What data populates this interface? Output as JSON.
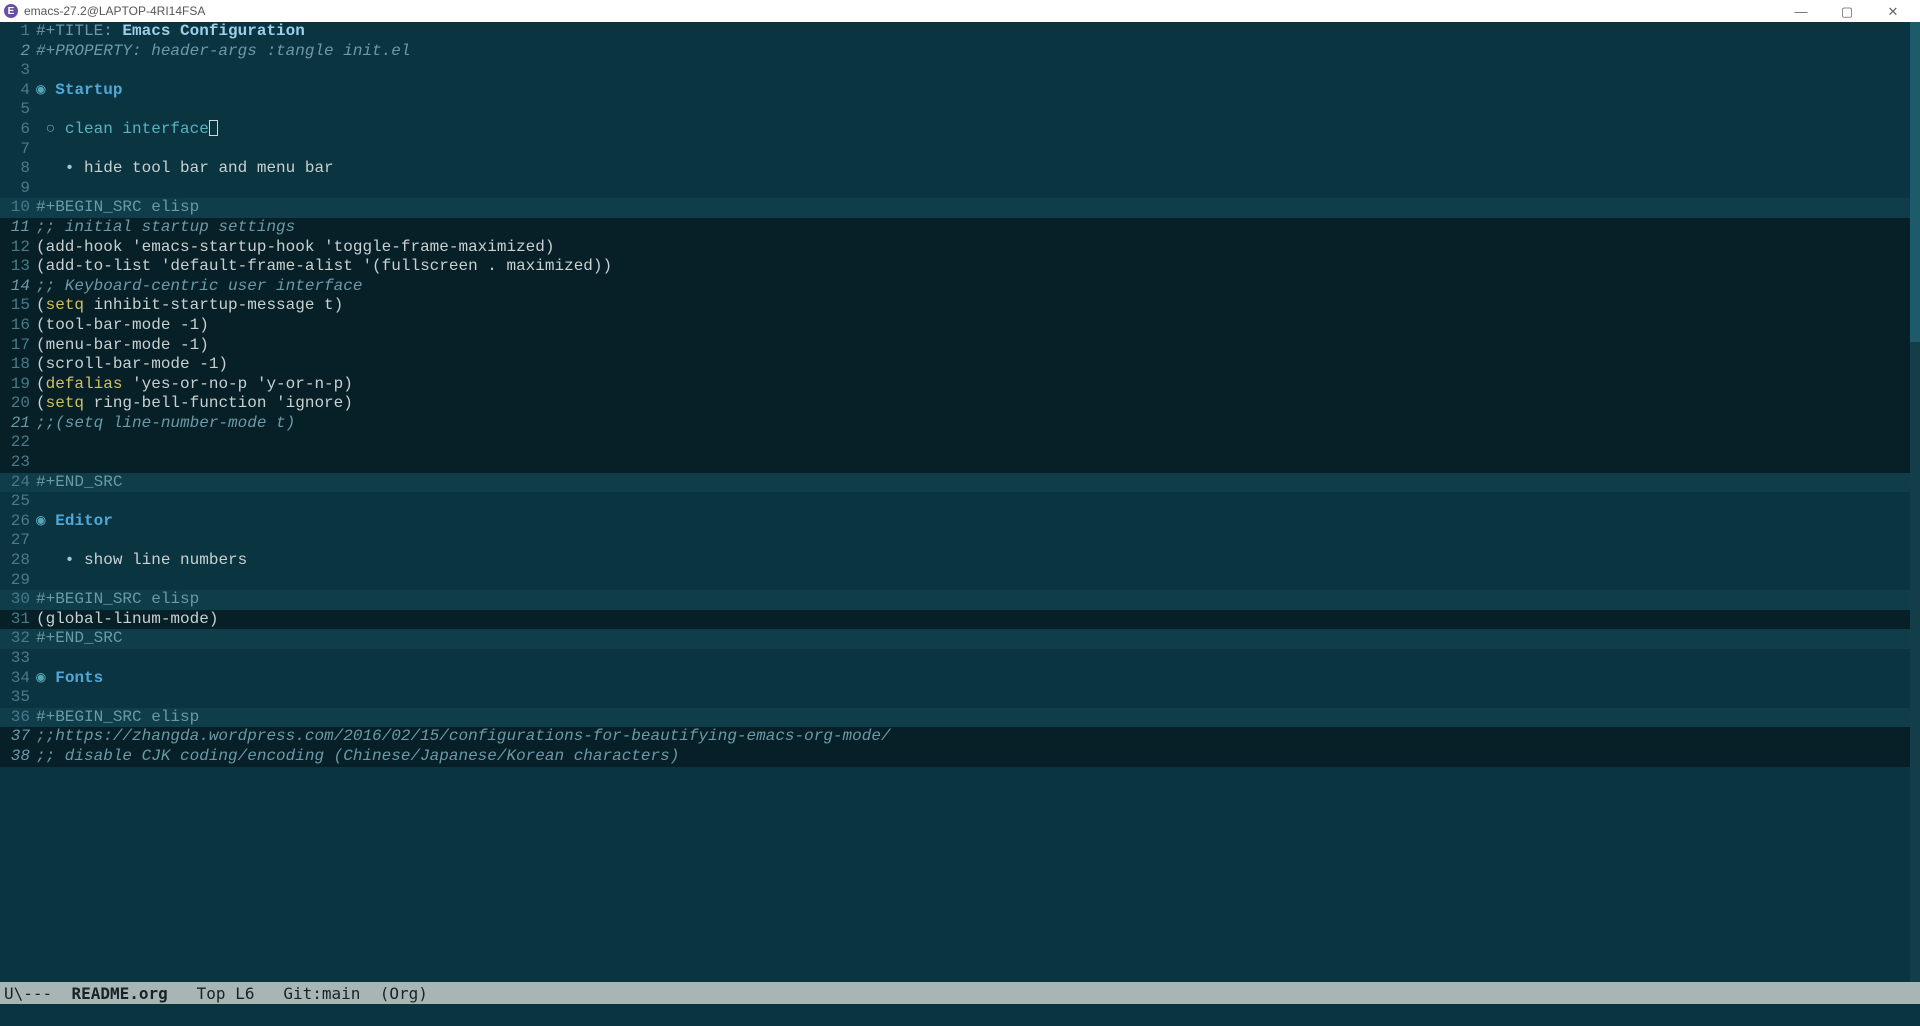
{
  "window": {
    "title": "emacs-27.2@LAPTOP-4RI14FSA",
    "icon_letter": "E"
  },
  "modeline": {
    "left": "U\\---  ",
    "buffer": "README.org",
    "pos": "   Top L6",
    "vc": "   Git:main",
    "mode": "  (Org)"
  },
  "lines": [
    {
      "n": "1",
      "italic": false,
      "bg": "normal",
      "spans": [
        {
          "cls": "c-meta",
          "t": "#+TITLE: "
        },
        {
          "cls": "c-title",
          "t": "Emacs Configuration"
        }
      ]
    },
    {
      "n": "2",
      "italic": true,
      "bg": "normal",
      "spans": [
        {
          "cls": "c-comment",
          "t": "#+PROPERTY: header-args :tangle init.el"
        }
      ]
    },
    {
      "n": "3",
      "italic": false,
      "bg": "normal",
      "spans": [
        {
          "cls": "c-text",
          "t": ""
        }
      ]
    },
    {
      "n": "4",
      "italic": false,
      "bg": "normal",
      "spans": [
        {
          "cls": "c-marker",
          "t": "◉ "
        },
        {
          "cls": "c-heading1",
          "t": "Startup"
        }
      ]
    },
    {
      "n": "5",
      "italic": false,
      "bg": "normal",
      "spans": [
        {
          "cls": "c-text",
          "t": ""
        }
      ]
    },
    {
      "n": "6",
      "italic": false,
      "bg": "normal",
      "cursor": true,
      "spans": [
        {
          "cls": "c-marker",
          "t": " ○ "
        },
        {
          "cls": "c-heading2",
          "t": "clean interface"
        }
      ]
    },
    {
      "n": "7",
      "italic": false,
      "bg": "normal",
      "spans": [
        {
          "cls": "c-text",
          "t": ""
        }
      ]
    },
    {
      "n": "8",
      "italic": false,
      "bg": "normal",
      "spans": [
        {
          "cls": "c-bullet",
          "t": "   • "
        },
        {
          "cls": "c-text",
          "t": "hide tool bar and menu bar"
        }
      ]
    },
    {
      "n": "9",
      "italic": false,
      "bg": "normal",
      "spans": [
        {
          "cls": "c-text",
          "t": ""
        }
      ]
    },
    {
      "n": "10",
      "italic": false,
      "bg": "begin",
      "spans": [
        {
          "cls": "c-meta",
          "t": "#+BEGIN_SRC elisp"
        }
      ]
    },
    {
      "n": "11",
      "italic": true,
      "bg": "src",
      "spans": [
        {
          "cls": "c-comment",
          "t": ";; initial startup settings"
        }
      ]
    },
    {
      "n": "12",
      "italic": false,
      "bg": "src",
      "spans": [
        {
          "cls": "c-text",
          "t": "(add-hook 'emacs-startup-hook 'toggle-frame-maximized)"
        }
      ]
    },
    {
      "n": "13",
      "italic": false,
      "bg": "src",
      "spans": [
        {
          "cls": "c-text",
          "t": "(add-to-list 'default-frame-alist '(fullscreen . maximized))"
        }
      ]
    },
    {
      "n": "14",
      "italic": true,
      "bg": "src",
      "spans": [
        {
          "cls": "c-comment",
          "t": ";; Keyboard-centric user interface"
        }
      ]
    },
    {
      "n": "15",
      "italic": false,
      "bg": "src",
      "spans": [
        {
          "cls": "c-text",
          "t": "("
        },
        {
          "cls": "c-keyword",
          "t": "setq"
        },
        {
          "cls": "c-text",
          "t": " inhibit-startup-message t)"
        }
      ]
    },
    {
      "n": "16",
      "italic": false,
      "bg": "src",
      "spans": [
        {
          "cls": "c-text",
          "t": "(tool-bar-mode -1)"
        }
      ]
    },
    {
      "n": "17",
      "italic": false,
      "bg": "src",
      "spans": [
        {
          "cls": "c-text",
          "t": "(menu-bar-mode -1)"
        }
      ]
    },
    {
      "n": "18",
      "italic": false,
      "bg": "src",
      "spans": [
        {
          "cls": "c-text",
          "t": "(scroll-bar-mode -1)"
        }
      ]
    },
    {
      "n": "19",
      "italic": false,
      "bg": "src",
      "spans": [
        {
          "cls": "c-text",
          "t": "("
        },
        {
          "cls": "c-keyword",
          "t": "defalias"
        },
        {
          "cls": "c-text",
          "t": " 'yes-or-no-p 'y-or-n-p)"
        }
      ]
    },
    {
      "n": "20",
      "italic": false,
      "bg": "src",
      "spans": [
        {
          "cls": "c-text",
          "t": "("
        },
        {
          "cls": "c-keyword",
          "t": "setq"
        },
        {
          "cls": "c-text",
          "t": " ring-bell-function 'ignore)"
        }
      ]
    },
    {
      "n": "21",
      "italic": true,
      "bg": "src",
      "spans": [
        {
          "cls": "c-comment",
          "t": ";;(setq line-number-mode t)"
        }
      ]
    },
    {
      "n": "22",
      "italic": false,
      "bg": "src",
      "spans": [
        {
          "cls": "c-text",
          "t": ""
        }
      ]
    },
    {
      "n": "23",
      "italic": false,
      "bg": "src",
      "spans": [
        {
          "cls": "c-text",
          "t": ""
        }
      ]
    },
    {
      "n": "24",
      "italic": false,
      "bg": "begin",
      "spans": [
        {
          "cls": "c-meta",
          "t": "#+END_SRC"
        }
      ]
    },
    {
      "n": "25",
      "italic": false,
      "bg": "normal",
      "spans": [
        {
          "cls": "c-text",
          "t": ""
        }
      ]
    },
    {
      "n": "26",
      "italic": false,
      "bg": "normal",
      "spans": [
        {
          "cls": "c-marker",
          "t": "◉ "
        },
        {
          "cls": "c-heading1",
          "t": "Editor"
        }
      ]
    },
    {
      "n": "27",
      "italic": false,
      "bg": "normal",
      "spans": [
        {
          "cls": "c-text",
          "t": ""
        }
      ]
    },
    {
      "n": "28",
      "italic": false,
      "bg": "normal",
      "spans": [
        {
          "cls": "c-bullet",
          "t": "   • "
        },
        {
          "cls": "c-text",
          "t": "show line numbers"
        }
      ]
    },
    {
      "n": "29",
      "italic": false,
      "bg": "normal",
      "spans": [
        {
          "cls": "c-text",
          "t": ""
        }
      ]
    },
    {
      "n": "30",
      "italic": false,
      "bg": "begin",
      "spans": [
        {
          "cls": "c-meta",
          "t": "#+BEGIN_SRC elisp"
        }
      ]
    },
    {
      "n": "31",
      "italic": false,
      "bg": "src",
      "spans": [
        {
          "cls": "c-text",
          "t": "(global-linum-mode)"
        }
      ]
    },
    {
      "n": "32",
      "italic": false,
      "bg": "begin",
      "spans": [
        {
          "cls": "c-meta",
          "t": "#+END_SRC"
        }
      ]
    },
    {
      "n": "33",
      "italic": false,
      "bg": "normal",
      "spans": [
        {
          "cls": "c-text",
          "t": ""
        }
      ]
    },
    {
      "n": "34",
      "italic": false,
      "bg": "normal",
      "spans": [
        {
          "cls": "c-marker",
          "t": "◉ "
        },
        {
          "cls": "c-heading1",
          "t": "Fonts"
        }
      ]
    },
    {
      "n": "35",
      "italic": false,
      "bg": "normal",
      "spans": [
        {
          "cls": "c-text",
          "t": ""
        }
      ]
    },
    {
      "n": "36",
      "italic": false,
      "bg": "begin",
      "spans": [
        {
          "cls": "c-meta",
          "t": "#+BEGIN_SRC elisp"
        }
      ]
    },
    {
      "n": "37",
      "italic": true,
      "bg": "src",
      "spans": [
        {
          "cls": "c-comment",
          "t": ";;https://zhangda.wordpress.com/2016/02/15/configurations-for-beautifying-emacs-org-mode/"
        }
      ]
    },
    {
      "n": "38",
      "italic": true,
      "bg": "src",
      "spans": [
        {
          "cls": "c-comment",
          "t": ";; disable CJK coding/encoding (Chinese/Japanese/Korean characters)"
        }
      ]
    }
  ]
}
